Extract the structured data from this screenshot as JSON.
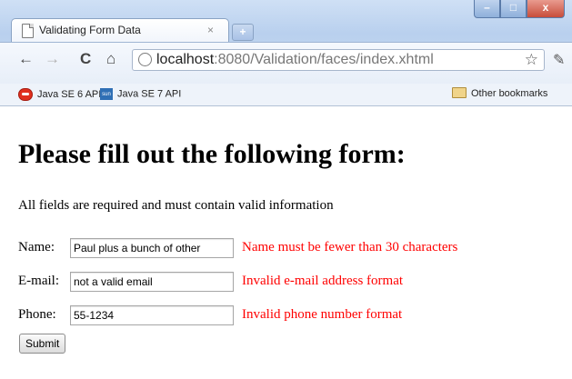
{
  "browser": {
    "tab_title": "Validating Form Data",
    "tab_close": "×",
    "new_tab": "+",
    "window_buttons": {
      "minimize": "–",
      "maximize": "□",
      "close": "x"
    },
    "back": "←",
    "forward": "→",
    "reload": "C",
    "home": "⌂",
    "url_host": "localhost",
    "url_rest": ":8080/Validation/faces/index.xhtml",
    "star": "☆",
    "wrench": "✎"
  },
  "bookmarks": {
    "items": [
      {
        "label": "Java SE 6 API",
        "icon": "java-icon"
      },
      {
        "label": "Java SE 7 API",
        "icon": "sun-java-icon"
      }
    ],
    "other": "Other bookmarks"
  },
  "page": {
    "heading": "Please fill out the following form:",
    "instructions": "All fields are required and must contain valid information",
    "fields": [
      {
        "label": "Name:",
        "value": "Paul plus a bunch of other",
        "error": "Name must be fewer than 30 characters"
      },
      {
        "label": "E-mail:",
        "value": "not a valid email",
        "error": "Invalid e-mail address format"
      },
      {
        "label": "Phone:",
        "value": "55-1234",
        "error": "Invalid phone number format"
      }
    ],
    "submit_label": "Submit"
  },
  "colors": {
    "error": "#ff0000",
    "chrome": "#c5d8f1"
  }
}
